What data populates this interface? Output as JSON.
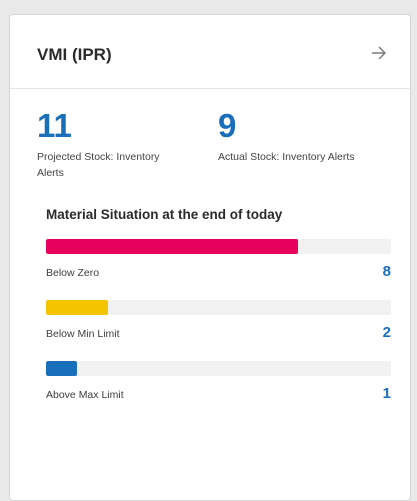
{
  "card": {
    "title": "VMI (IPR)",
    "nav_icon": "arrow-right-icon"
  },
  "kpis": [
    {
      "value": "11",
      "label": "Projected Stock: Inventory Alerts"
    },
    {
      "value": "9",
      "label": "Actual Stock: Inventory Alerts"
    }
  ],
  "situation": {
    "title": "Material Situation at the end of today",
    "rows": [
      {
        "label": "Below Zero",
        "count": "8",
        "fill_fraction": 0.73,
        "color": "#e8005f"
      },
      {
        "label": "Below Min Limit",
        "count": "2",
        "fill_fraction": 0.18,
        "color": "#f5c400"
      },
      {
        "label": "Above Max Limit",
        "count": "1",
        "fill_fraction": 0.09,
        "color": "#1a6fba"
      }
    ]
  }
}
